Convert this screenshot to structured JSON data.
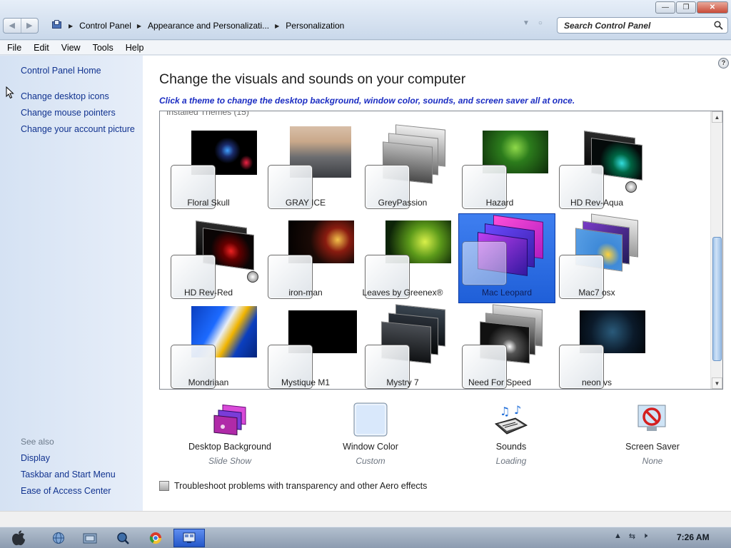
{
  "address_bar": {
    "breadcrumbs": [
      "Control Panel",
      "Appearance and Personalizati...",
      "Personalization"
    ],
    "search_placeholder": "Search Control Panel"
  },
  "menu": [
    "File",
    "Edit",
    "View",
    "Tools",
    "Help"
  ],
  "sidebar": {
    "home": "Control Panel Home",
    "links": [
      "Change desktop icons",
      "Change mouse pointers",
      "Change your account picture"
    ],
    "see_also_label": "See also",
    "see_also": [
      "Display",
      "Taskbar and Start Menu",
      "Ease of Access Center"
    ]
  },
  "main": {
    "title": "Change the visuals and sounds on your computer",
    "subtitle": "Click a theme to change the desktop background, window color, sounds, and screen saver all at once.",
    "group_label": "Installed Themes (15)",
    "selected_theme": "Mac Leopard",
    "themes": [
      {
        "name": "Floral Skull",
        "icon": "floral-skull-thumbnail"
      },
      {
        "name": "GRAY ICE",
        "icon": "gray-ice-thumbnail"
      },
      {
        "name": "GreyPassion",
        "icon": "greypassion-thumbnail"
      },
      {
        "name": "Hazard",
        "icon": "hazard-thumbnail"
      },
      {
        "name": "HD Rev-Aqua",
        "icon": "hd-rev-aqua-thumbnail"
      },
      {
        "name": "HD Rev-Red",
        "icon": "hd-rev-red-thumbnail"
      },
      {
        "name": "iron-man",
        "icon": "iron-man-thumbnail"
      },
      {
        "name": "Leaves by Greenex®",
        "icon": "leaves-thumbnail"
      },
      {
        "name": "Mac Leopard",
        "icon": "mac-leopard-thumbnail"
      },
      {
        "name": "Mac7 osx",
        "icon": "mac7-osx-thumbnail"
      },
      {
        "name": "Mondriaan",
        "icon": "mondriaan-thumbnail"
      },
      {
        "name": "Mystique M1",
        "icon": "mystique-thumbnail"
      },
      {
        "name": "Mystry 7",
        "icon": "mystry-thumbnail"
      },
      {
        "name": "Need For Speed",
        "icon": "need-for-speed-thumbnail"
      },
      {
        "name": "neon vs",
        "icon": "neon-vs-thumbnail"
      }
    ],
    "settings": [
      {
        "label": "Desktop Background",
        "value": "Slide Show",
        "icon": "desktop-background-icon"
      },
      {
        "label": "Window Color",
        "value": "Custom",
        "icon": "window-color-icon"
      },
      {
        "label": "Sounds",
        "value": "Loading",
        "icon": "sounds-icon"
      },
      {
        "label": "Screen Saver",
        "value": "None",
        "icon": "screen-saver-icon"
      }
    ],
    "troubleshoot": "Troubleshoot problems with transparency and other Aero effects"
  },
  "taskbar": {
    "clock": "7:26 AM"
  },
  "colors": {
    "link": "#10328f",
    "subtitle": "#1a2cc2",
    "selection": "#2f6fe6"
  }
}
